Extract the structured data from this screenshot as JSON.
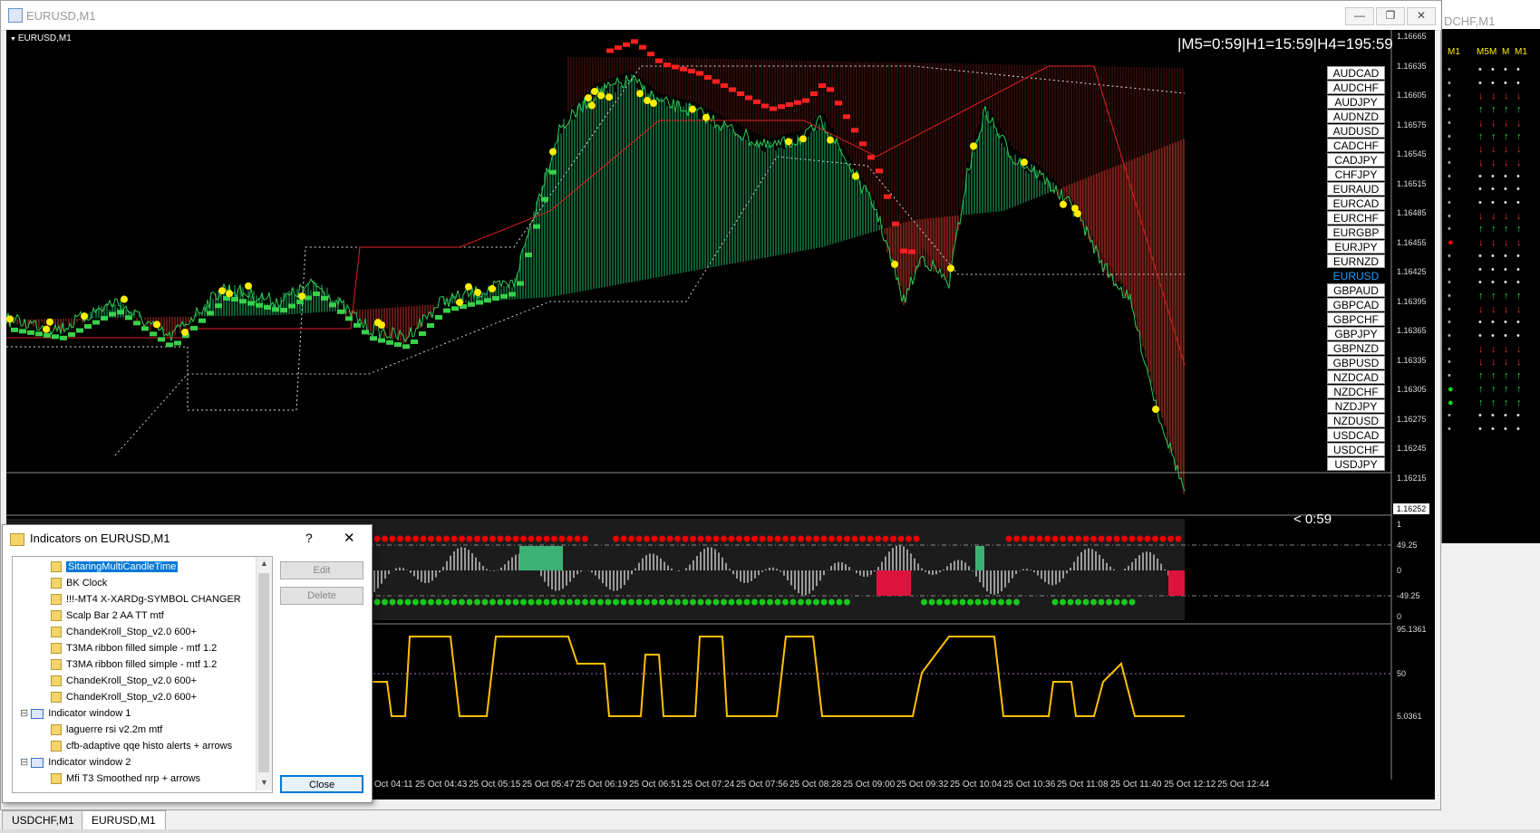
{
  "window": {
    "title": "EURUSD,M1",
    "minimize_icon": "minimize-icon",
    "maximize_icon": "restore-icon",
    "close_icon": "close-icon"
  },
  "chart": {
    "symbol_label": "EURUSD,M1",
    "clock_text": "|M5=0:59|H1=15:59|H4=195:59",
    "countdown": "< 0:59",
    "current_price": "1.16252",
    "price_levels": [
      "1.16665",
      "1.16635",
      "1.16605",
      "1.16575",
      "1.16545",
      "1.16515",
      "1.16485",
      "1.16455",
      "1.16425",
      "1.16395",
      "1.16365",
      "1.16335",
      "1.16305",
      "1.16275",
      "1.16245",
      "1.16215"
    ],
    "time_labels": [
      "25 Oct 04:11",
      "25 Oct 04:43",
      "25 Oct 05:15",
      "25 Oct 05:47",
      "25 Oct 06:19",
      "25 Oct 06:51",
      "25 Oct 07:24",
      "25 Oct 07:56",
      "25 Oct 08:28",
      "25 Oct 09:00",
      "25 Oct 09:32",
      "25 Oct 10:04",
      "25 Oct 10:36",
      "25 Oct 11:08",
      "25 Oct 11:40",
      "25 Oct 12:12",
      "25 Oct 12:44"
    ],
    "window1_levels": [
      "1",
      "49.25",
      "0",
      "-49.25",
      "0"
    ],
    "window2_levels": [
      "95.1361",
      "50",
      "5.0361"
    ],
    "colors": {
      "bull": "#1fbf6a",
      "bear": "#c0392b",
      "dot": "#ffee00",
      "teal": "#2aa3b8"
    }
  },
  "symbols": [
    "AUDCAD",
    "AUDCHF",
    "AUDJPY",
    "AUDNZD",
    "AUDUSD",
    "CADCHF",
    "CADJPY",
    "CHFJPY",
    "EURAUD",
    "EURCAD",
    "EURCHF",
    "EURGBP",
    "EURJPY",
    "EURNZD",
    "EURUSD",
    "GBPAUD",
    "GBPCAD",
    "GBPCHF",
    "GBPJPY",
    "GBPNZD",
    "GBPUSD",
    "NZDCAD",
    "NZDCHF",
    "NZDJPY",
    "NZDUSD",
    "USDCAD",
    "USDCHF",
    "USDJPY"
  ],
  "active_symbol": "EURUSD",
  "second_window": {
    "title": "DCHF,M1",
    "columns": [
      "M1",
      "M5",
      "M",
      "M",
      "M1"
    ]
  },
  "dialog": {
    "title": "Indicators on EURUSD,M1",
    "help_label": "?",
    "close_x": "✕",
    "items": [
      {
        "label": "SitaringMultiCandleTime",
        "level": 2,
        "selected": true,
        "icon": "indicator-icon"
      },
      {
        "label": "BK Clock",
        "level": 2,
        "icon": "indicator-icon"
      },
      {
        "label": "!!!-MT4 X-XARDg-SYMBOL CHANGER",
        "level": 2,
        "icon": "indicator-icon"
      },
      {
        "label": "Scalp Bar 2 AA TT mtf",
        "level": 2,
        "icon": "indicator-icon"
      },
      {
        "label": "ChandeKroll_Stop_v2.0 600+",
        "level": 2,
        "icon": "indicator-icon"
      },
      {
        "label": "T3MA ribbon filled simple - mtf 1.2",
        "level": 2,
        "icon": "indicator-icon"
      },
      {
        "label": "T3MA ribbon filled simple - mtf 1.2",
        "level": 2,
        "icon": "indicator-icon"
      },
      {
        "label": "ChandeKroll_Stop_v2.0 600+",
        "level": 2,
        "icon": "indicator-icon"
      },
      {
        "label": "ChandeKroll_Stop_v2.0 600+",
        "level": 2,
        "icon": "indicator-icon"
      },
      {
        "label": "Indicator window 1",
        "level": 1,
        "icon": "window-icon"
      },
      {
        "label": "laguerre rsi v2.2m mtf",
        "level": 2,
        "icon": "indicator-icon"
      },
      {
        "label": "cfb-adaptive qqe histo alerts + arrows",
        "level": 2,
        "icon": "indicator-icon"
      },
      {
        "label": "Indicator window 2",
        "level": 1,
        "icon": "window-icon"
      },
      {
        "label": "Mfi T3 Smoothed nrp + arrows",
        "level": 2,
        "icon": "indicator-icon"
      }
    ],
    "buttons": {
      "edit": "Edit",
      "delete": "Delete",
      "close": "Close"
    }
  },
  "tabs": [
    "USDCHF,M1",
    "EURUSD,M1"
  ],
  "active_tab": "EURUSD,M1"
}
